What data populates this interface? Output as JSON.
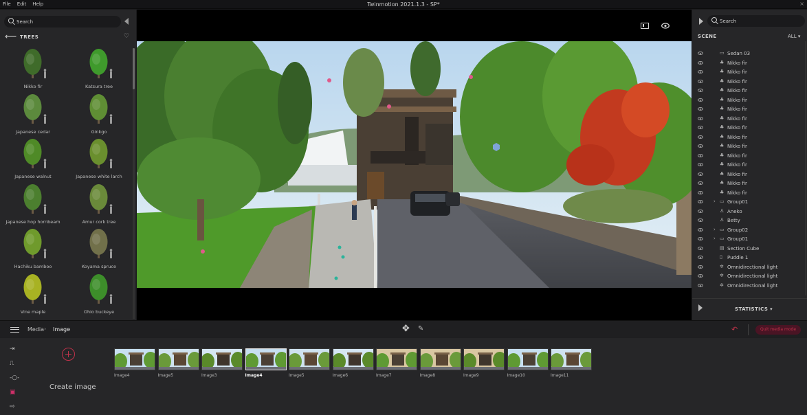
{
  "app": {
    "menu": [
      "File",
      "Edit",
      "Help"
    ],
    "title": "Twinmotion 2021.1.3 - SP*",
    "close_glyph": "×"
  },
  "library": {
    "search_placeholder": "Search",
    "category": "TREES",
    "items": [
      {
        "label": "Nikko fir",
        "color": "#3f6b2a"
      },
      {
        "label": "Katsura tree",
        "color": "#3f9a2c"
      },
      {
        "label": "Japanese cedar",
        "color": "#5c8a3d"
      },
      {
        "label": "Ginkgo",
        "color": "#5f8e34"
      },
      {
        "label": "Japanese walnut",
        "color": "#4f8a27"
      },
      {
        "label": "Japanese white larch",
        "color": "#6a8f2e"
      },
      {
        "label": "Japanese hop hornbeam",
        "color": "#4c7f2f"
      },
      {
        "label": "Amur cork tree",
        "color": "#6a8a3a"
      },
      {
        "label": "Hachiku bamboo",
        "color": "#6f9a2c"
      },
      {
        "label": "Koyama spruce",
        "color": "#71704a"
      },
      {
        "label": "Vine maple",
        "color": "#a8b223"
      },
      {
        "label": "Ohio buckeye",
        "color": "#3d8e2a"
      }
    ]
  },
  "scene": {
    "search_placeholder": "Search",
    "label": "SCENE",
    "filter": "ALL",
    "items": [
      {
        "name": "Sedan 03",
        "icon": "folder",
        "chevron": false
      },
      {
        "name": "Nikko fir",
        "icon": "tree",
        "chevron": false
      },
      {
        "name": "Nikko fir",
        "icon": "tree",
        "chevron": false
      },
      {
        "name": "Nikko fir",
        "icon": "tree",
        "chevron": false
      },
      {
        "name": "Nikko fir",
        "icon": "tree",
        "chevron": false
      },
      {
        "name": "Nikko fir",
        "icon": "tree",
        "chevron": false
      },
      {
        "name": "Nikko fir",
        "icon": "tree",
        "chevron": false
      },
      {
        "name": "Nikko fir",
        "icon": "tree",
        "chevron": false
      },
      {
        "name": "Nikko fir",
        "icon": "tree",
        "chevron": false
      },
      {
        "name": "Nikko fir",
        "icon": "tree",
        "chevron": false
      },
      {
        "name": "Nikko fir",
        "icon": "tree",
        "chevron": false
      },
      {
        "name": "Nikko fir",
        "icon": "tree",
        "chevron": false
      },
      {
        "name": "Nikko fir",
        "icon": "tree",
        "chevron": false
      },
      {
        "name": "Nikko fir",
        "icon": "tree",
        "chevron": false
      },
      {
        "name": "Nikko fir",
        "icon": "tree",
        "chevron": false
      },
      {
        "name": "Nikko fir",
        "icon": "tree",
        "chevron": false
      },
      {
        "name": "Group01",
        "icon": "folder",
        "chevron": true
      },
      {
        "name": "Aneko",
        "icon": "person",
        "chevron": false
      },
      {
        "name": "Betty",
        "icon": "person",
        "chevron": false
      },
      {
        "name": "Group02",
        "icon": "folder",
        "chevron": true
      },
      {
        "name": "Group01",
        "icon": "folder",
        "chevron": true
      },
      {
        "name": "Section Cube",
        "icon": "cube",
        "chevron": false
      },
      {
        "name": "Puddle 1",
        "icon": "doc",
        "chevron": false
      },
      {
        "name": "Omnidirectional light",
        "icon": "light",
        "chevron": false
      },
      {
        "name": "Omnidirectional light",
        "icon": "light",
        "chevron": false
      },
      {
        "name": "Omnidirectional light",
        "icon": "light",
        "chevron": false
      }
    ],
    "statistics_label": "STATISTICS ▾"
  },
  "toolbar": {
    "breadcrumb_media": "Media",
    "breadcrumb_sep": "›",
    "breadcrumb_image": "Image",
    "quit_label": "Quit media mode"
  },
  "media": {
    "create_label": "Create image",
    "thumbnails": [
      {
        "label": "Image4",
        "selected": false
      },
      {
        "label": "Image5",
        "selected": false
      },
      {
        "label": "Image3",
        "selected": false
      },
      {
        "label": "Image4",
        "selected": true
      },
      {
        "label": "Image5",
        "selected": false
      },
      {
        "label": "Image6",
        "selected": false
      },
      {
        "label": "Image7",
        "selected": false
      },
      {
        "label": "Image8",
        "selected": false
      },
      {
        "label": "Image9",
        "selected": false
      },
      {
        "label": "Image10",
        "selected": false
      },
      {
        "label": "Image11",
        "selected": false
      }
    ]
  },
  "colors": {
    "accent": "#c0324a",
    "panel": "#262628",
    "sky": "#c7dff0",
    "foliage": "#3f7a2a",
    "red_foliage": "#c23a1f"
  }
}
